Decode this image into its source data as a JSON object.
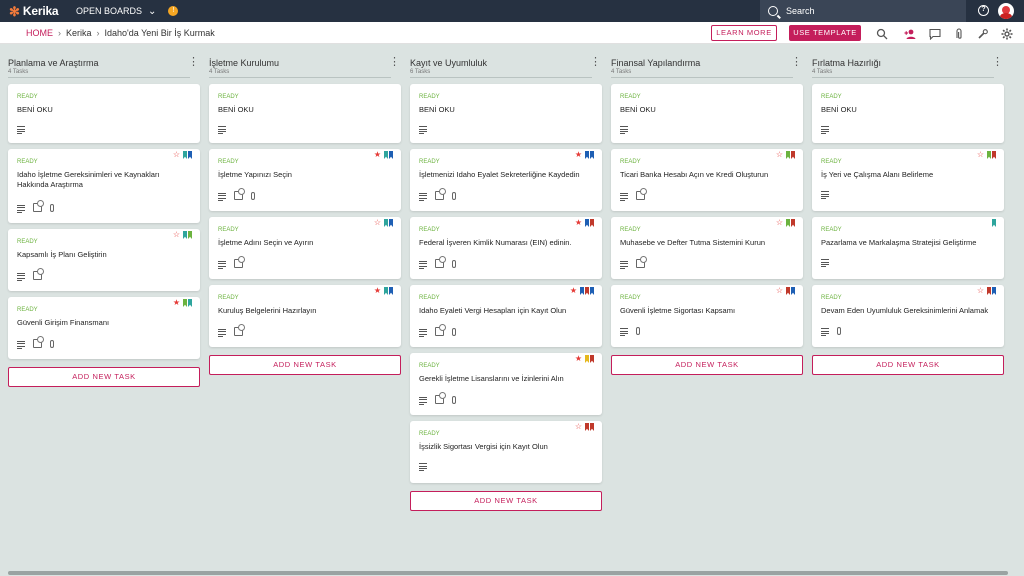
{
  "app": {
    "name": "Kerika",
    "open_boards_label": "OPEN BOARDS",
    "org_badge": "!"
  },
  "search": {
    "placeholder": "Search"
  },
  "breadcrumb": {
    "home": "HOME",
    "team": "Kerika",
    "board": "Idaho'da Yeni Bir İş Kurmak"
  },
  "header_buttons": {
    "learn_more": "LEARN MORE",
    "use_template": "USE TEMPLATE"
  },
  "colors": {
    "accent": "#c41e5b",
    "topbar": "#263141",
    "ready": "#6cb33f",
    "board_bg": "#dbe3e1",
    "tag_blue": "#1e5fb4",
    "tag_teal": "#2ea59d",
    "tag_green": "#6cb33f",
    "tag_red": "#c0392b",
    "tag_gold": "#e6b91e"
  },
  "columns": [
    {
      "title": "Planlama ve Araştırma",
      "count": "4 Tasks",
      "add_label": "ADD NEW TASK",
      "cards": [
        {
          "status": "READY",
          "title": "BENİ OKU",
          "star": "none",
          "tags": [],
          "icons": [
            "description"
          ]
        },
        {
          "status": "READY",
          "title": "Idaho İşletme Gereksinimleri ve Kaynakları Hakkında Araştırma",
          "star": "outline",
          "tags": [
            "teal",
            "blue"
          ],
          "icons": [
            "description",
            "checklist",
            "attachment"
          ]
        },
        {
          "status": "READY",
          "title": "Kapsamlı İş Planı Geliştirin",
          "star": "outline",
          "tags": [
            "teal",
            "green"
          ],
          "icons": [
            "description",
            "checklist"
          ]
        },
        {
          "status": "READY",
          "title": "Güvenli Girişim Finansmanı",
          "star": "filled",
          "tags": [
            "green",
            "teal"
          ],
          "icons": [
            "description",
            "checklist",
            "attachment"
          ]
        }
      ]
    },
    {
      "title": "İşletme Kurulumu",
      "count": "4 Tasks",
      "add_label": "ADD NEW TASK",
      "cards": [
        {
          "status": "READY",
          "title": "BENİ OKU",
          "star": "none",
          "tags": [],
          "icons": [
            "description"
          ]
        },
        {
          "status": "READY",
          "title": "İşletme Yapınızı Seçin",
          "star": "filled",
          "tags": [
            "teal",
            "blue"
          ],
          "icons": [
            "description",
            "checklist",
            "attachment"
          ]
        },
        {
          "status": "READY",
          "title": "İşletme Adını Seçin ve Ayırın",
          "star": "outline",
          "tags": [
            "teal",
            "blue"
          ],
          "icons": [
            "description",
            "checklist"
          ]
        },
        {
          "status": "READY",
          "title": "Kuruluş Belgelerini Hazırlayın",
          "star": "filled",
          "tags": [
            "teal",
            "blue"
          ],
          "icons": [
            "description",
            "checklist"
          ]
        }
      ]
    },
    {
      "title": "Kayıt ve Uyumluluk",
      "count": "6 Tasks",
      "add_label": "ADD NEW TASK",
      "cards": [
        {
          "status": "READY",
          "title": "BENİ OKU",
          "star": "none",
          "tags": [],
          "icons": [
            "description"
          ]
        },
        {
          "status": "READY",
          "title": "İşletmenizi Idaho Eyalet Sekreterliğine Kaydedin",
          "star": "filled",
          "tags": [
            "blue",
            "blue"
          ],
          "icons": [
            "description",
            "checklist",
            "attachment"
          ]
        },
        {
          "status": "READY",
          "title": "Federal İşveren Kimlik Numarası (EIN) edinin.",
          "star": "filled",
          "tags": [
            "blue",
            "red"
          ],
          "icons": [
            "description",
            "checklist",
            "attachment"
          ]
        },
        {
          "status": "READY",
          "title": "Idaho Eyaleti Vergi Hesapları için Kayıt Olun",
          "star": "filled",
          "tags": [
            "blue",
            "red",
            "blue"
          ],
          "icons": [
            "description",
            "checklist",
            "attachment"
          ]
        },
        {
          "status": "READY",
          "title": "Gerekli İşletme Lisanslarını ve İzinlerini Alın",
          "star": "filled",
          "tags": [
            "gold",
            "red"
          ],
          "icons": [
            "description",
            "checklist",
            "attachment"
          ]
        },
        {
          "status": "READY",
          "title": "İşsizlik Sigortası Vergisi için Kayıt Olun",
          "star": "outline",
          "tags": [
            "red",
            "red"
          ],
          "icons": [
            "description"
          ]
        }
      ]
    },
    {
      "title": "Finansal Yapılandırma",
      "count": "4 Tasks",
      "add_label": "ADD NEW TASK",
      "cards": [
        {
          "status": "READY",
          "title": "BENİ OKU",
          "star": "none",
          "tags": [],
          "icons": [
            "description"
          ]
        },
        {
          "status": "READY",
          "title": "Ticari Banka Hesabı Açın ve Kredi Oluşturun",
          "star": "outline",
          "tags": [
            "green",
            "red"
          ],
          "icons": [
            "description",
            "checklist"
          ]
        },
        {
          "status": "READY",
          "title": "Muhasebe ve Defter Tutma Sistemini Kurun",
          "star": "outline",
          "tags": [
            "green",
            "red"
          ],
          "icons": [
            "description",
            "checklist"
          ]
        },
        {
          "status": "READY",
          "title": "Güvenli İşletme Sigortası Kapsamı",
          "star": "outline",
          "tags": [
            "red",
            "blue"
          ],
          "icons": [
            "description",
            "attachment"
          ]
        }
      ]
    },
    {
      "title": "Fırlatma Hazırlığı",
      "count": "4 Tasks",
      "add_label": "ADD NEW TASK",
      "cards": [
        {
          "status": "READY",
          "title": "BENİ OKU",
          "star": "none",
          "tags": [],
          "icons": [
            "description"
          ]
        },
        {
          "status": "READY",
          "title": "İş Yeri ve Çalışma Alanı Belirleme",
          "star": "outline",
          "tags": [
            "green",
            "red"
          ],
          "icons": [
            "description"
          ]
        },
        {
          "status": "READY",
          "title": "Pazarlama ve Markalaşma Stratejisi Geliştirme",
          "star": "none",
          "tags": [
            "teal"
          ],
          "icons": [
            "description"
          ]
        },
        {
          "status": "READY",
          "title": "Devam Eden Uyumluluk Gereksinimlerini Anlamak",
          "star": "outline",
          "tags": [
            "red",
            "blue"
          ],
          "icons": [
            "description",
            "attachment"
          ]
        }
      ]
    }
  ]
}
